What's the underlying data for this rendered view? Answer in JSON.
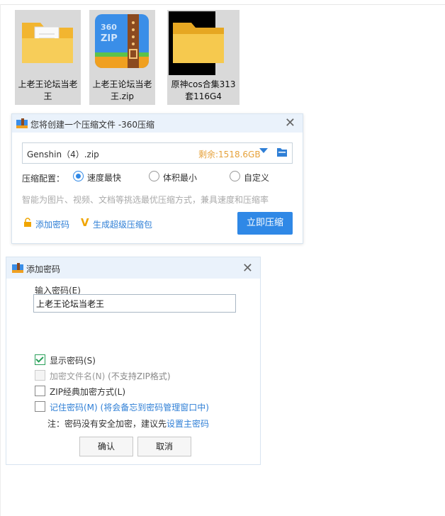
{
  "files": [
    {
      "name": "上老王论坛当老王",
      "icon": "folder-with-documents-icon"
    },
    {
      "name": "上老王论坛当老王.zip",
      "icon": "360zip-archive-icon",
      "badge": "360\nZIP"
    },
    {
      "name": "原神cos合集313套116G4",
      "icon": "folder-icon"
    }
  ],
  "compress_dialog": {
    "title": "您将创建一个压缩文件 -360压缩",
    "filename": "Genshin（4）.zip",
    "free_space": "剩余:1518.6GB",
    "config_label": "压缩配置：",
    "options": [
      "速度最快",
      "体积最小",
      "自定义"
    ],
    "selected_option": "速度最快",
    "hint": "智能为图片、视频、文档等挑选最优压缩方式，兼具速度和压缩率",
    "add_password": "添加密码",
    "super_pack": "生成超级压缩包",
    "compress_button": "立即压缩"
  },
  "password_dialog": {
    "title": "添加密码",
    "input_label": "输入密码(E)",
    "password_value": "上老王论坛当老王",
    "checkboxes": [
      {
        "label": "显示密码(S)",
        "checked": true,
        "disabled": false
      },
      {
        "label": "加密文件名(N)",
        "extra": "(不支持ZIP格式)",
        "checked": false,
        "disabled": true
      },
      {
        "label": "ZIP经典加密方式(L)",
        "checked": false,
        "disabled": false
      },
      {
        "label": "记住密码(M)",
        "extra": "(将会备忘到密码管理窗口中)",
        "checked": false,
        "disabled": false
      }
    ],
    "note_prefix": "注：密码没有安全加密，建议先",
    "note_link": "设置主密码",
    "ok_button": "确认",
    "cancel_button": "取消"
  },
  "colors": {
    "accent": "#2f88e6",
    "free_space": "#e6a23c",
    "titlebar": "#eaf2fb",
    "check": "#2aa05a"
  }
}
